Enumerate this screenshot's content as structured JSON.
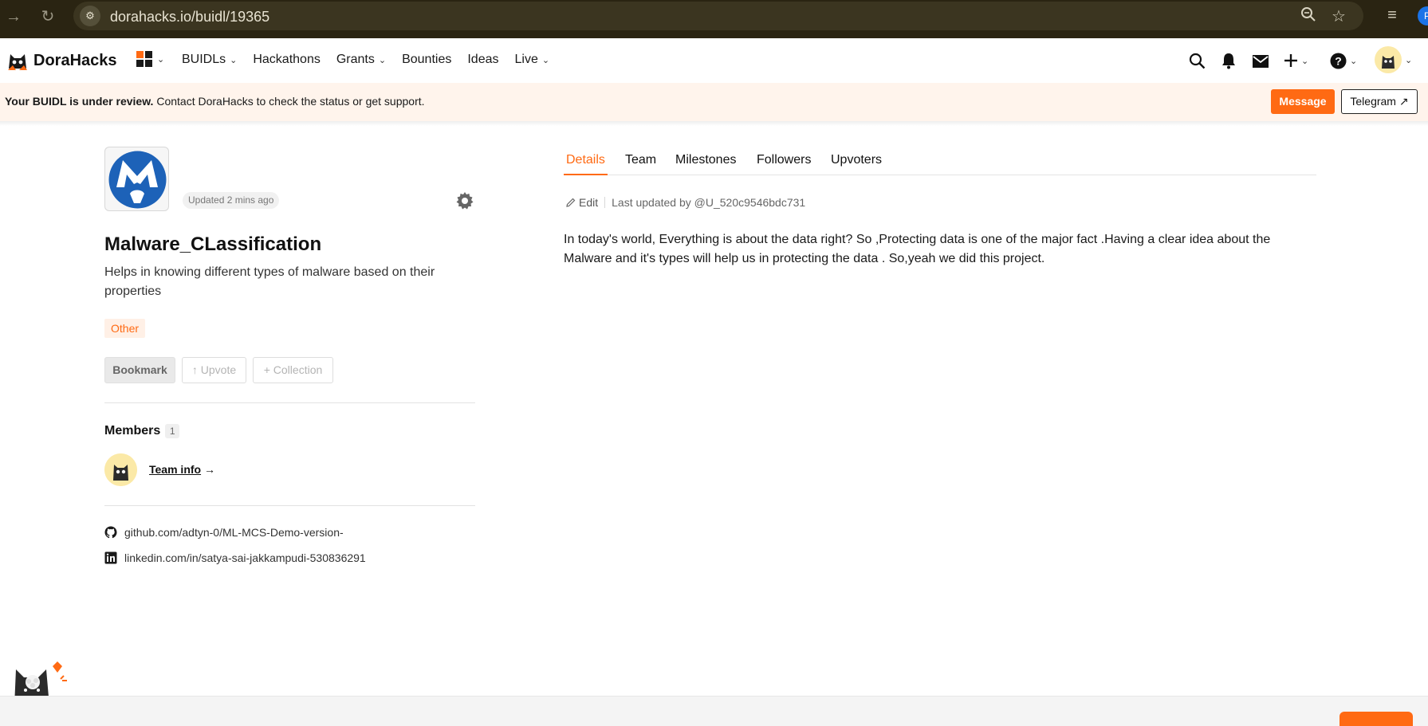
{
  "browser": {
    "url": "dorahacks.io/buidl/19365",
    "profile_initial": "P"
  },
  "header": {
    "brand": "DoraHacks",
    "nav": [
      {
        "label": "BUIDLs",
        "dropdown": true
      },
      {
        "label": "Hackathons",
        "dropdown": false
      },
      {
        "label": "Grants",
        "dropdown": true
      },
      {
        "label": "Bounties",
        "dropdown": false
      },
      {
        "label": "Ideas",
        "dropdown": false
      },
      {
        "label": "Live",
        "dropdown": true
      }
    ],
    "icons": [
      "search-icon",
      "bell-icon",
      "mail-icon",
      "plus-icon",
      "help-icon",
      "avatar"
    ]
  },
  "banner": {
    "bold": "Your BUIDL is under review.",
    "text": " Contact DoraHacks to check the status or get support.",
    "message_label": "Message",
    "telegram_label": "Telegram ↗"
  },
  "project": {
    "updated": "Updated 2 mins ago",
    "title": "Malware_CLassification",
    "description": "Helps in knowing different types of malware based on their properties",
    "tag": "Other",
    "bookmark_label": "Bookmark",
    "upvote_label": "↑ Upvote",
    "collection_label": "+ Collection",
    "members_label": "Members",
    "members_count": "1",
    "team_info_label": "Team info",
    "team_info_arrow": " →",
    "links": [
      {
        "icon": "github-icon",
        "text": "github.com/adtyn-0/ML-MCS-Demo-version-"
      },
      {
        "icon": "linkedin-icon",
        "text": "linkedin.com/in/satya-sai-jakkampudi-530836291"
      }
    ]
  },
  "details": {
    "tabs": [
      "Details",
      "Team",
      "Milestones",
      "Followers",
      "Upvoters"
    ],
    "active_tab": "Details",
    "edit_label": "Edit",
    "last_updated": "Last updated by @U_520c9546bdc731",
    "body": "In today's world, Everything is about the data right? So ,Protecting data is one of the major fact .Having a clear idea about the Malware and it's types will help us in protecting the data . So,yeah we did this project."
  },
  "colors": {
    "accent": "#ff6a13",
    "banner_bg": "#fff4ec",
    "chrome_bg": "#2a2412"
  }
}
